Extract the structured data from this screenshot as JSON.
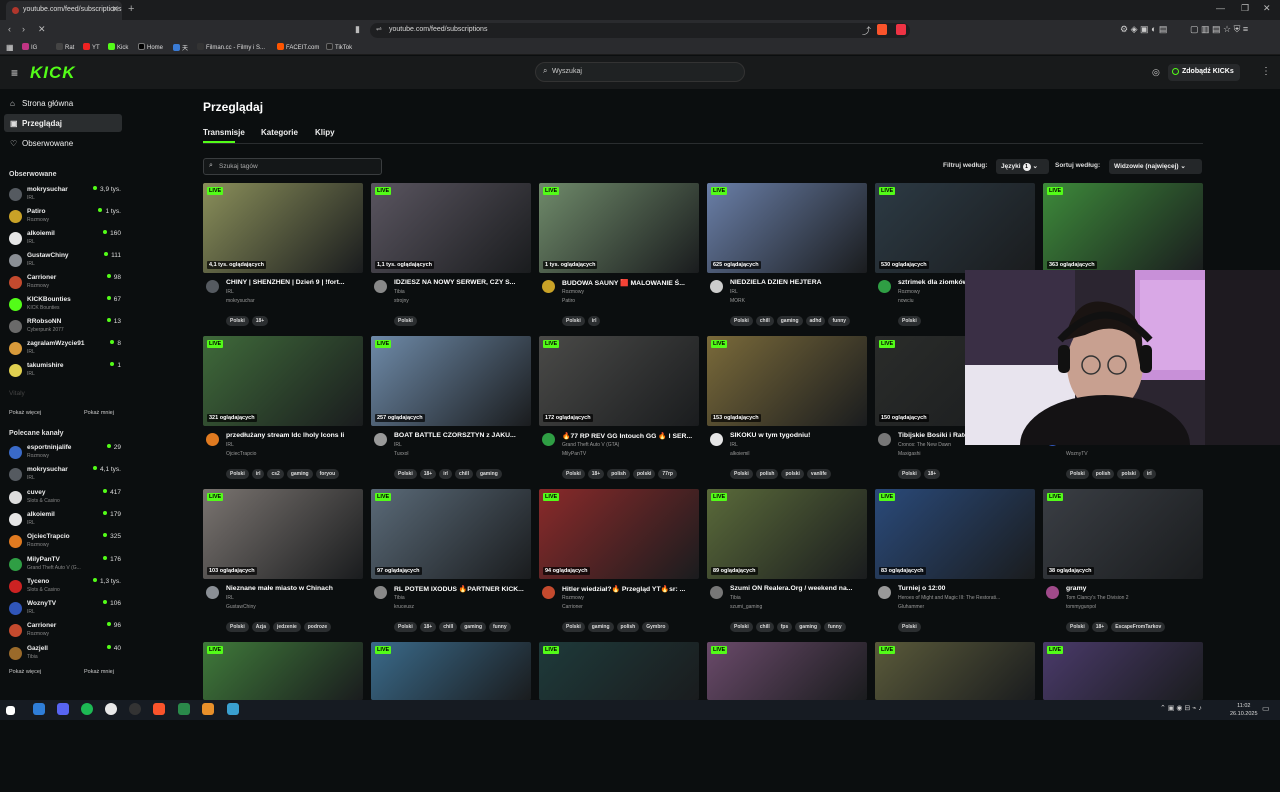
{
  "browser": {
    "tab_title": "youtube.com/feed/subscriptions",
    "url": "youtube.com/feed/subscriptions",
    "bookmarks": [
      "IG",
      "Rat",
      "YT",
      "Kick",
      "Home",
      "天",
      "Filman.cc - Filmy i S...",
      "FACEIT.com",
      "TikTok"
    ]
  },
  "header": {
    "logo": "KICK",
    "search_placeholder": "Wyszukaj",
    "kicks_button": "Zdobądź KICKs"
  },
  "sidebar": {
    "nav": [
      {
        "label": "Strona główna",
        "icon": "home-icon"
      },
      {
        "label": "Przeglądaj",
        "icon": "compass-icon"
      },
      {
        "label": "Obserwowane",
        "icon": "heart-icon"
      }
    ],
    "followed_heading": "Obserwowane",
    "followed": [
      {
        "name": "mokrysuchar",
        "category": "IRL",
        "viewers": "3,9 tys.",
        "color": "#555a60"
      },
      {
        "name": "Patiro",
        "category": "Rozmowy",
        "viewers": "1 tys.",
        "color": "#c9a227"
      },
      {
        "name": "alkoiemil",
        "category": "IRL",
        "viewers": "160",
        "color": "#e6e6e6"
      },
      {
        "name": "GustawChiny",
        "category": "IRL",
        "viewers": "111",
        "color": "#8a8f95"
      },
      {
        "name": "Carrioner",
        "category": "Rozmowy",
        "viewers": "98",
        "color": "#c44a2e"
      },
      {
        "name": "KICKBounties",
        "category": "KICK Bounties",
        "viewers": "67",
        "color": "#53fc18"
      },
      {
        "name": "RRobsoNN",
        "category": "Cyberpunk 2077",
        "viewers": "13",
        "color": "#6a6a6a"
      },
      {
        "name": "zagralamWzycie91",
        "category": "IRL",
        "viewers": "8",
        "color": "#d89a3a"
      },
      {
        "name": "takumishire",
        "category": "IRL",
        "viewers": "1",
        "color": "#e0d050"
      }
    ],
    "faded_item": "Vitaly",
    "show_more": "Pokaż więcej",
    "show_less": "Pokaż mniej",
    "recommended_heading": "Polecane kanały",
    "recommended": [
      {
        "name": "esportninjalife",
        "category": "Rozmowy",
        "viewers": "29",
        "color": "#3a6ac8"
      },
      {
        "name": "mokrysuchar",
        "category": "IRL",
        "viewers": "4,1 tys.",
        "color": "#555a60"
      },
      {
        "name": "cuvey",
        "category": "Slots & Casino",
        "viewers": "417",
        "color": "#ddd"
      },
      {
        "name": "alkoiemil",
        "category": "IRL",
        "viewers": "179",
        "color": "#e6e6e6"
      },
      {
        "name": "OjciecTrapcio",
        "category": "Rozmowy",
        "viewers": "325",
        "color": "#e07a20"
      },
      {
        "name": "MilyPanTV",
        "category": "Grand Theft Auto V (G...",
        "viewers": "176",
        "color": "#2f9e44"
      },
      {
        "name": "Tyceno",
        "category": "Slots & Casino",
        "viewers": "1,3 tys.",
        "color": "#c22"
      },
      {
        "name": "WoznyTV",
        "category": "IRL",
        "viewers": "106",
        "color": "#3055b8"
      },
      {
        "name": "Carrioner",
        "category": "Rozmowy",
        "viewers": "96",
        "color": "#c44a2e"
      },
      {
        "name": "Gazjell",
        "category": "Tibia",
        "viewers": "40",
        "color": "#9a6a2a"
      }
    ]
  },
  "main": {
    "title": "Przeglądaj",
    "tabs": [
      "Transmisje",
      "Kategorie",
      "Klipy"
    ],
    "tag_search_placeholder": "Szukaj tagów",
    "filter_label": "Filtruj według:",
    "filter_value": "Języki",
    "filter_count": "1",
    "sort_label": "Sortuj według:",
    "sort_value": "Widzowie (najwięcej)",
    "live_label": "LIVE"
  },
  "streams": [
    {
      "title": "CHINY | SHENZHEN | Dzień 9 | !fort...",
      "category": "IRL",
      "user": "mokrysuchar",
      "viewers": "4,1 tys. oglądających",
      "tags": [
        "Polski",
        "18+"
      ],
      "thumb": "#8a8f5a",
      "avatar": "#555a60"
    },
    {
      "title": "IDZIESZ NA NOWY SERWER, CZY S...",
      "category": "Tibia",
      "user": "strojny",
      "viewers": "1,1 tys. oglądających",
      "tags": [
        "Polski"
      ],
      "thumb": "#5a5560",
      "avatar": "#888"
    },
    {
      "title": "BUDOWA SAUNY 🟥 MALOWANIE Ś...",
      "category": "Rozmowy",
      "user": "Patiro",
      "viewers": "1 tys. oglądających",
      "tags": [
        "Polski",
        "irl"
      ],
      "thumb": "#6f8a6a",
      "avatar": "#c9a227"
    },
    {
      "title": "NIEDZIELA DZIEŃ HEJTERA",
      "category": "IRL",
      "user": "MORK",
      "viewers": "625 oglądających",
      "tags": [
        "Polski",
        "chill",
        "gaming",
        "adhd",
        "funny"
      ],
      "thumb": "#6a7fa8",
      "avatar": "#ccc"
    },
    {
      "title": "sztrimek dla ziomków",
      "category": "Rozmowy",
      "user": "nowciu",
      "viewers": "530 oglądających",
      "tags": [
        "Polski"
      ],
      "thumb": "#2c3a44",
      "avatar": "#2f9e44"
    },
    {
      "title": "",
      "category": "",
      "user": "",
      "viewers": "363 oglądających",
      "tags": [],
      "thumb": "#3d8a3a",
      "avatar": "#555"
    },
    {
      "title": "przedłużany stream ldc lholy Icons li",
      "category": "IRL",
      "user": "OjciecTrapcio",
      "viewers": "321 oglądających",
      "tags": [
        "Polski",
        "irl",
        "cs2",
        "gaming",
        "foryou"
      ],
      "thumb": "#3f6a3a",
      "avatar": "#e07a20"
    },
    {
      "title": "BOAT BATTLE CZORSZTYN z JAKU...",
      "category": "IRL",
      "user": "Tuxxol",
      "viewers": "257 oglądających",
      "tags": [
        "Polski",
        "18+",
        "irl",
        "chill",
        "gaming"
      ],
      "thumb": "#6e8aa8",
      "avatar": "#999"
    },
    {
      "title": "🔥77 RP REV GG Intouch GG 🔥 I SER...",
      "category": "Grand Theft Auto V (GTA)",
      "user": "MilyPanTV",
      "viewers": "172 oglądających",
      "tags": [
        "Polski",
        "18+",
        "polish",
        "polski",
        "77rp"
      ],
      "thumb": "#4a4a48",
      "avatar": "#2f9e44"
    },
    {
      "title": "SIKOKU w tym tygodniu!",
      "category": "IRL",
      "user": "alkoiemil",
      "viewers": "153 oglądających",
      "tags": [
        "Polski",
        "polish",
        "polski",
        "vanlife"
      ],
      "thumb": "#7a6a3a",
      "avatar": "#e6e6e6"
    },
    {
      "title": "Tibijskie Bosiki i Ratc...",
      "category": "Cronos: The New Dawn",
      "user": "Maxigashi",
      "viewers": "150 oglądających",
      "tags": [
        "Polski",
        "18+"
      ],
      "thumb": "#2a2c2a",
      "avatar": "#777"
    },
    {
      "title": "",
      "category": "",
      "user": "WoznyTV",
      "viewers": "",
      "tags": [
        "Polski",
        "polish",
        "polski",
        "irl"
      ],
      "thumb": "#222",
      "avatar": "#3055b8"
    },
    {
      "title": "Nieznane małe miasto w Chinach",
      "category": "IRL",
      "user": "GustawChiny",
      "viewers": "103 oglądających",
      "tags": [
        "Polski",
        "Azja",
        "jedzenie",
        "podroze"
      ],
      "thumb": "#7a7470",
      "avatar": "#8a8f95"
    },
    {
      "title": "RL POTEM IXODUS 🔥PARTNER KICK...",
      "category": "Tibia",
      "user": "kruceusz",
      "viewers": "97 oglądających",
      "tags": [
        "Polski",
        "18+",
        "chill",
        "gaming",
        "funny"
      ],
      "thumb": "#5a6a78",
      "avatar": "#888"
    },
    {
      "title": "Hitler wiedział?🔥 Przegląd YT🔥sr: ...",
      "category": "Rozmowy",
      "user": "Carrioner",
      "viewers": "94 oglądających",
      "tags": [
        "Polski",
        "gaming",
        "polish",
        "Gymbro"
      ],
      "thumb": "#8a2a2a",
      "avatar": "#c44a2e"
    },
    {
      "title": "Szumi ON Realera.Org / weekend na...",
      "category": "Tibia",
      "user": "szumi_gaming",
      "viewers": "89 oglądających",
      "tags": [
        "Polski",
        "chill",
        "fps",
        "gaming",
        "funny"
      ],
      "thumb": "#5a6a3a",
      "avatar": "#777"
    },
    {
      "title": "Turniej o 12:00",
      "category": "Heroes of Might and Magic III: The Restorati...",
      "user": "Gluhammer",
      "viewers": "83 oglądających",
      "tags": [
        "Polski"
      ],
      "thumb": "#2a4a7a",
      "avatar": "#999"
    },
    {
      "title": "gramy",
      "category": "Tom Clancy's The Division 2",
      "user": "tommygunpol",
      "viewers": "38 oglądających",
      "tags": [
        "Polski",
        "18+",
        "EscapeFromTarkov"
      ],
      "thumb": "#3a3e44",
      "avatar": "#a04a8a"
    },
    {
      "title": "",
      "category": "",
      "user": "",
      "viewers": "",
      "tags": [],
      "thumb": "#3f7a3a",
      "avatar": "#555"
    },
    {
      "title": "",
      "category": "",
      "user": "",
      "viewers": "",
      "tags": [],
      "thumb": "#3a6a8a",
      "avatar": "#555"
    },
    {
      "title": "",
      "category": "",
      "user": "",
      "viewers": "",
      "tags": [],
      "thumb": "#1e3a3a",
      "avatar": "#555"
    },
    {
      "title": "",
      "category": "",
      "user": "",
      "viewers": "",
      "tags": [],
      "thumb": "#6a4a6a",
      "avatar": "#555"
    },
    {
      "title": "",
      "category": "",
      "user": "",
      "viewers": "",
      "tags": [],
      "thumb": "#5a5a3a",
      "avatar": "#555"
    },
    {
      "title": "",
      "category": "",
      "user": "",
      "viewers": "",
      "tags": [],
      "thumb": "#4a3a6a",
      "avatar": "#555"
    }
  ],
  "taskbar": {
    "time": "11:02",
    "date": "26.10.2025"
  }
}
